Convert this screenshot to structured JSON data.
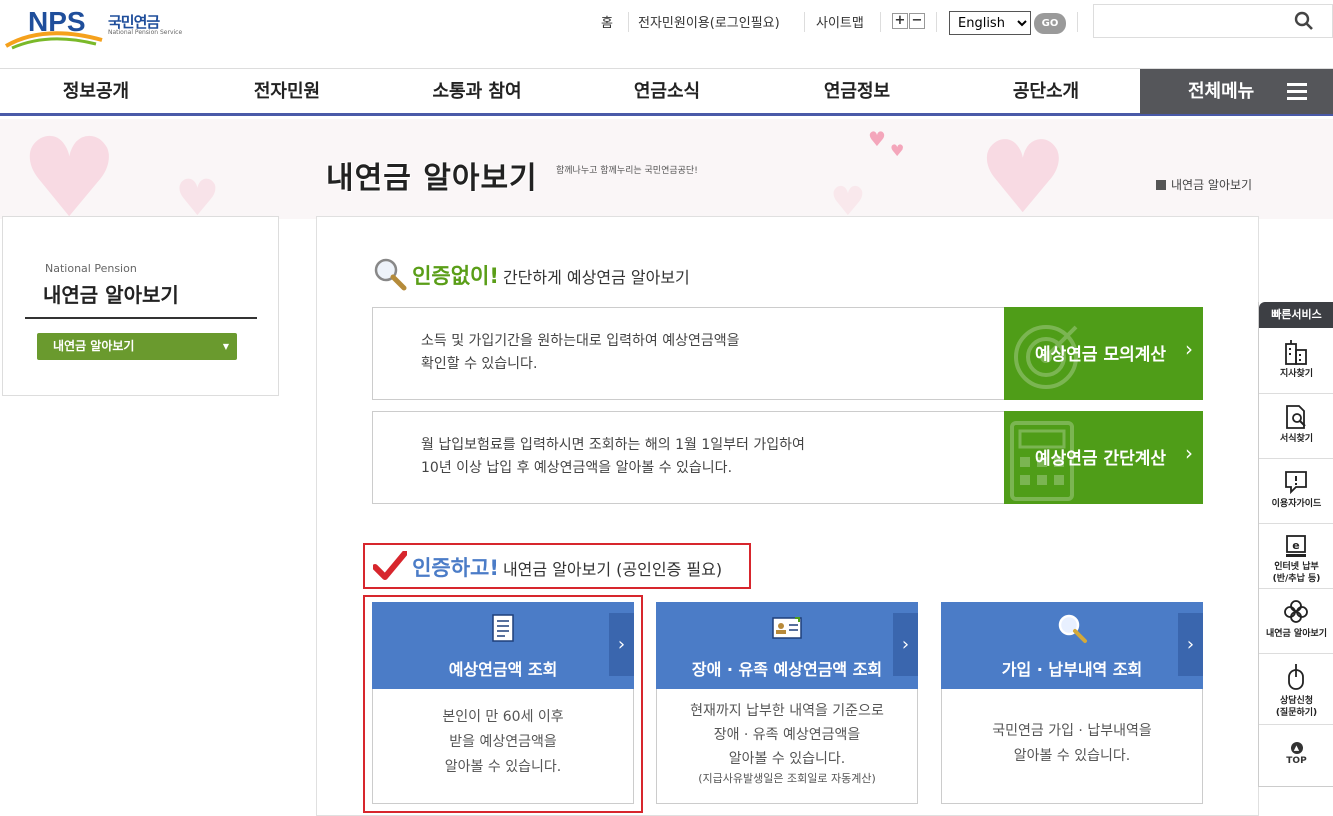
{
  "header": {
    "logo_text": "NPS",
    "logo_kr": "국민연금",
    "logo_en": "National Pension Service",
    "links": [
      "홈",
      "전자민원이용(로그인필요)",
      "사이트맵"
    ],
    "font_plus": "+",
    "font_minus": "−",
    "language": "English",
    "language_options": [
      "English"
    ],
    "go_label": "GO",
    "search_placeholder": ""
  },
  "nav": {
    "items": [
      "정보공개",
      "전자민원",
      "소통과 참여",
      "연금소식",
      "연금정보",
      "공단소개"
    ],
    "all_menu": "전체메뉴"
  },
  "banner": {
    "title": "내연금 알아보기",
    "subtitle": "함께나누고 함께누리는 국민연금공단!",
    "breadcrumb": "내연금 알아보기"
  },
  "sidebar": {
    "en_label": "National Pension",
    "title": "내연금 알아보기",
    "select_label": "내연금 알아보기"
  },
  "section1": {
    "strong": "인증없이!",
    "rest": "간단하게 예상연금 알아보기",
    "rows": [
      {
        "line1": "소득 및 가입기간을 원하는대로 입력하여 예상연금액을",
        "line2": "확인할 수 있습니다.",
        "button": "예상연금 모의계산",
        "arrow": "›"
      },
      {
        "line1": "월 납입보험료를 입력하시면 조회하는 해의 1월 1일부터 가입하여",
        "line2": "10년 이상 납입 후 예상연금액을 알아볼 수 있습니다.",
        "button": "예상연금 간단계산",
        "arrow": "›"
      }
    ]
  },
  "section2": {
    "strong": "인증하고!",
    "rest": "내연금 알아보기 (공인인증 필요)",
    "cards": [
      {
        "title": "예상연금액 조회",
        "line1": "본인이 만 60세 이후",
        "line2": "받을 예상연금액을",
        "line3": "알아볼 수 있습니다.",
        "note": "",
        "arrow": "›"
      },
      {
        "title": "장애 · 유족 예상연금액 조회",
        "line1": "현재까지 납부한 내역을 기준으로",
        "line2": "장애 · 유족 예상연금액을",
        "line3": "알아볼 수 있습니다.",
        "note": "(지급사유발생일은 조회일로 자동계산)",
        "arrow": "›"
      },
      {
        "title": "가입 · 납부내역 조회",
        "line1": "국민연금 가입 · 납부내역을",
        "line2": "알아볼 수 있습니다.",
        "line3": "",
        "note": "",
        "arrow": "›"
      }
    ]
  },
  "quick": {
    "title": "빠른서비스",
    "items": [
      {
        "l1": "지사찾기",
        "l2": ""
      },
      {
        "l1": "서식찾기",
        "l2": ""
      },
      {
        "l1": "이용자가이드",
        "l2": ""
      },
      {
        "l1": "인터넷 납부",
        "l2": "(반/추납 등)"
      },
      {
        "l1": "내연금 알아보기",
        "l2": ""
      },
      {
        "l1": "상담신청",
        "l2": "(질문하기)"
      }
    ],
    "top": "TOP"
  },
  "colors": {
    "nav_underline": "#4a5aa8",
    "green": "#4f9d18",
    "blue": "#4b7cc7",
    "highlight_red": "#d7262d"
  }
}
